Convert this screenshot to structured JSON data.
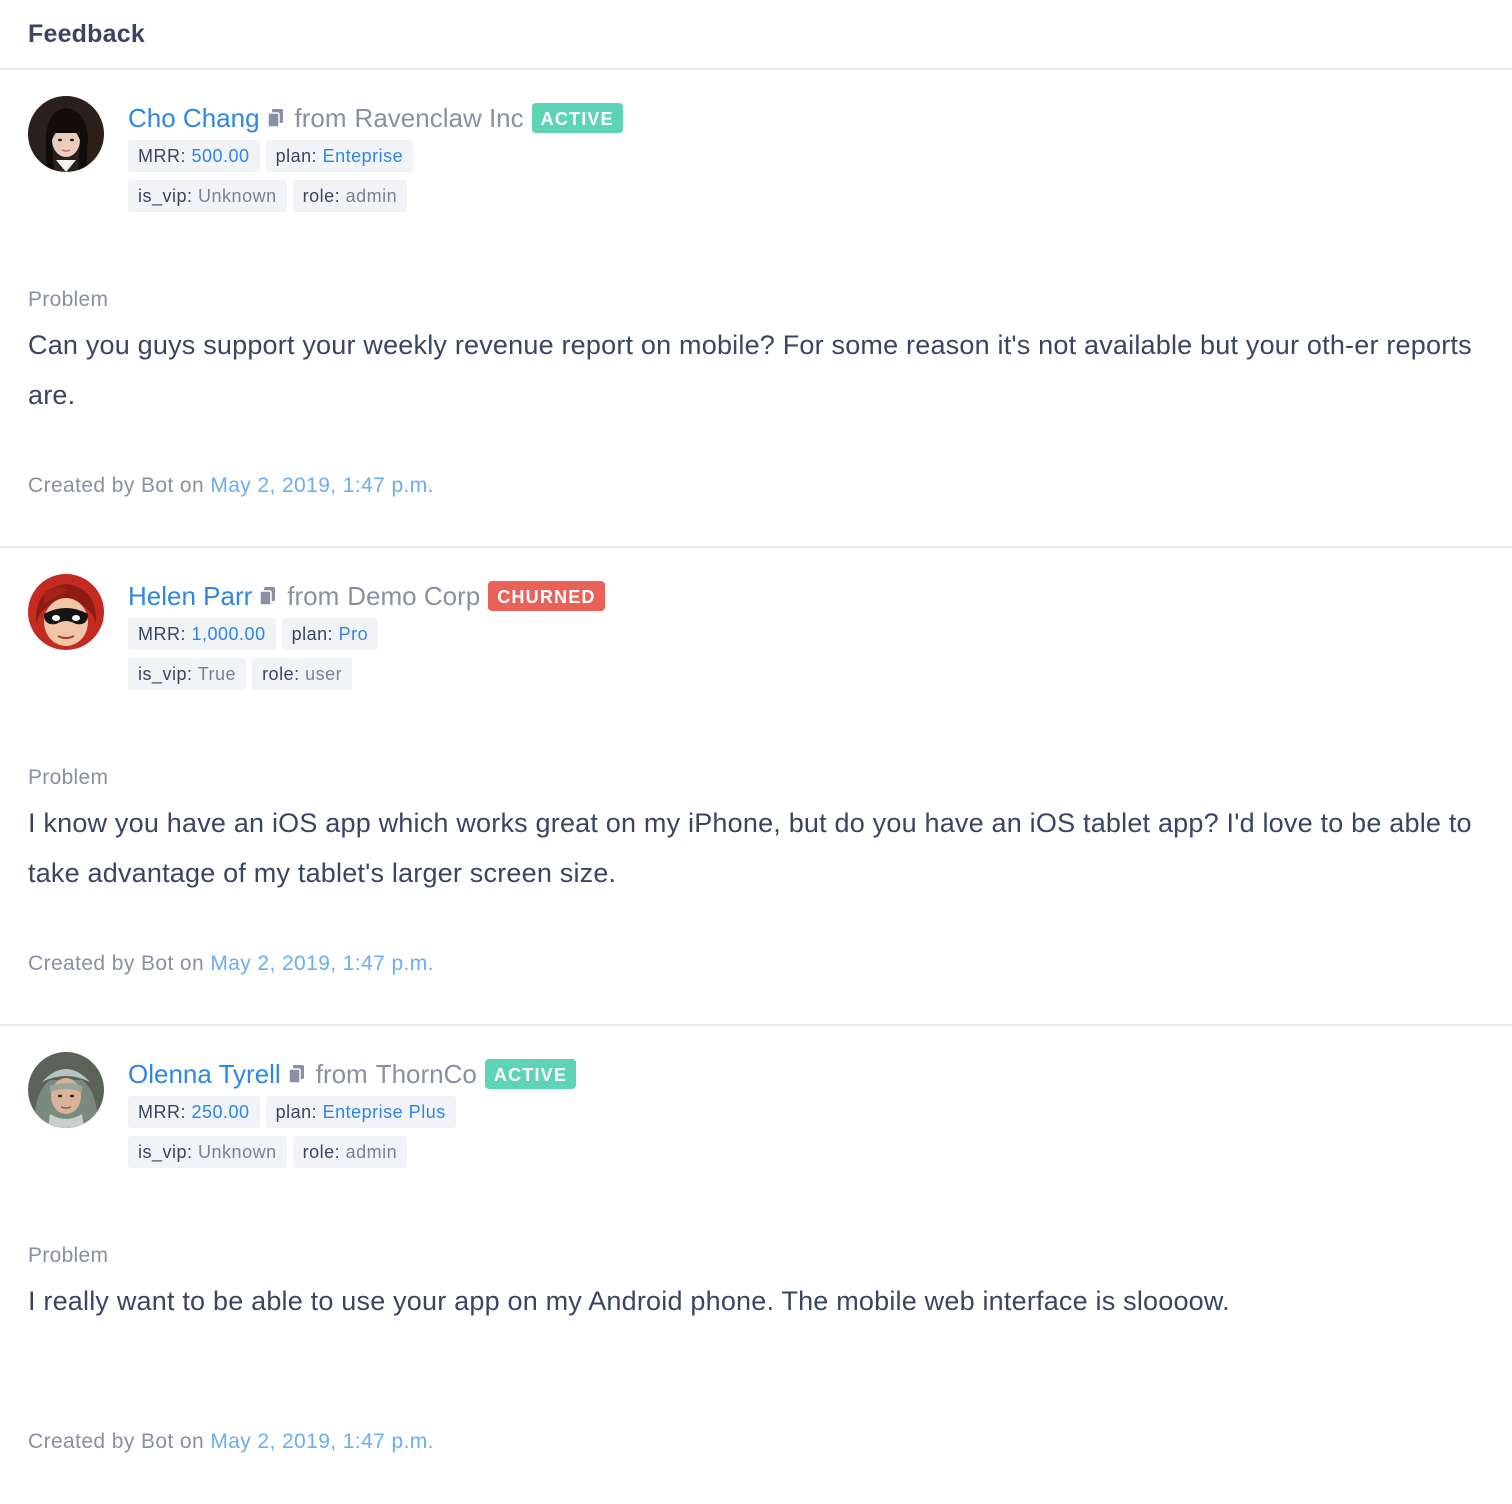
{
  "header": {
    "title": "Feedback"
  },
  "feedback": [
    {
      "user_name": "Cho Chang",
      "from_word": "from",
      "company": "Ravenclaw Inc",
      "status": "ACTIVE",
      "status_color": "#5fd3b8",
      "tags_row1": [
        {
          "key": "MRR:",
          "value": "500.00",
          "blue": true
        },
        {
          "key": "plan:",
          "value": "Enteprise",
          "blue": true
        }
      ],
      "tags_row2": [
        {
          "key": "is_vip:",
          "value": "Unknown",
          "blue": false
        },
        {
          "key": "role:",
          "value": "admin",
          "blue": false
        }
      ],
      "section_label": "Problem",
      "problem": "Can you guys support your weekly revenue report on mobile? For some reason it's not available but your oth-er reports are.",
      "created_prefix": "Created by Bot on",
      "created_date": "May 2, 2019, 1:47 p.m.",
      "avatar_icon": "avatar-dark-hair"
    },
    {
      "user_name": "Helen Parr",
      "from_word": "from",
      "company": "Demo Corp",
      "status": "CHURNED",
      "status_color": "#e8625a",
      "tags_row1": [
        {
          "key": "MRR:",
          "value": "1,000.00",
          "blue": true
        },
        {
          "key": "plan:",
          "value": "Pro",
          "blue": true
        }
      ],
      "tags_row2": [
        {
          "key": "is_vip:",
          "value": "True",
          "blue": false
        },
        {
          "key": "role:",
          "value": "user",
          "blue": false
        }
      ],
      "section_label": "Problem",
      "problem": "I know you have an iOS app which works great on my iPhone, but do you have an iOS tablet app? I'd love to be able to take advantage of my tablet's larger screen size.",
      "created_prefix": "Created by Bot on",
      "created_date": "May 2, 2019, 1:47 p.m.",
      "avatar_icon": "avatar-red-mask"
    },
    {
      "user_name": "Olenna Tyrell",
      "from_word": "from",
      "company": "ThornCo",
      "status": "ACTIVE",
      "status_color": "#5fd3b8",
      "tags_row1": [
        {
          "key": "MRR:",
          "value": "250.00",
          "blue": true
        },
        {
          "key": "plan:",
          "value": "Enteprise Plus",
          "blue": true
        }
      ],
      "tags_row2": [
        {
          "key": "is_vip:",
          "value": "Unknown",
          "blue": false
        },
        {
          "key": "role:",
          "value": "admin",
          "blue": false
        }
      ],
      "section_label": "Problem",
      "problem": "I really want to be able to use your app on my Android phone. The mobile web interface is sloooow.",
      "created_prefix": "Created by Bot on",
      "created_date": "May 2, 2019, 1:47 p.m.",
      "avatar_icon": "avatar-grey-headdress"
    }
  ]
}
